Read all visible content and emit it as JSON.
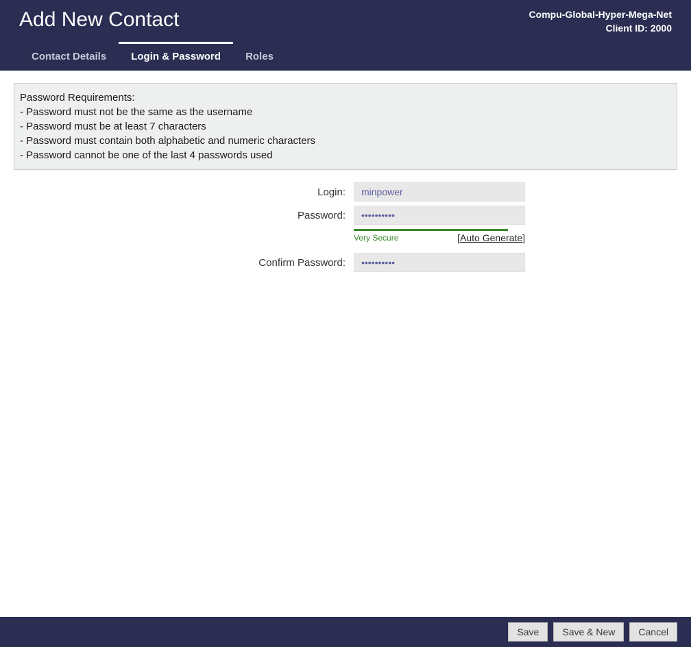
{
  "header": {
    "title": "Add New Contact",
    "client_name": "Compu-Global-Hyper-Mega-Net",
    "client_id_label": "Client ID: 2000",
    "tabs": [
      {
        "label": "Contact Details"
      },
      {
        "label": "Login & Password"
      },
      {
        "label": "Roles"
      }
    ],
    "active_tab": 1
  },
  "requirements": {
    "title": "Password Requirements:",
    "items": [
      "- Password must not be the same as the username",
      "- Password must be at least 7 characters",
      "- Password must contain both alphabetic and numeric characters",
      "- Password cannot be one of the last 4 passwords used"
    ]
  },
  "form": {
    "login_label": "Login:",
    "login_value": "minpower",
    "password_label": "Password:",
    "password_value": "••••••••••",
    "strength_label": "Very Secure",
    "auto_generate_prefix": "[",
    "auto_generate_label": "Auto Generate",
    "auto_generate_suffix": "]",
    "confirm_label": "Confirm Password:",
    "confirm_value": "••••••••••"
  },
  "footer": {
    "save": "Save",
    "save_new": "Save & New",
    "cancel": "Cancel"
  }
}
